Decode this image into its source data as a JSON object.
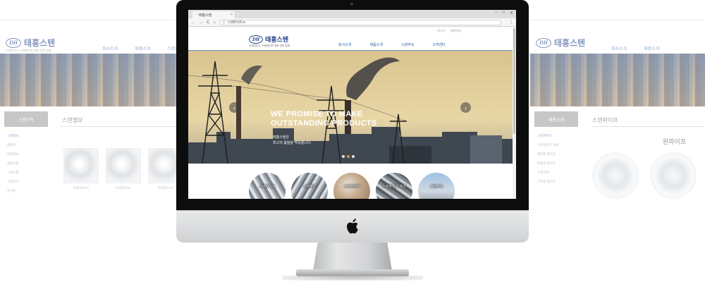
{
  "browser": {
    "tab_title": "태흥스텐",
    "url": "스텐파이프.kr",
    "tab_close": "×",
    "window_controls": [
      "–",
      "□",
      "✕"
    ],
    "nav_buttons": [
      "←",
      "→",
      "C",
      "⌂"
    ],
    "menu": "⋮"
  },
  "site": {
    "logo_badge": "DH",
    "logo_text": "태흥스텐",
    "tagline": "스테인리스, 스텐파이프 제작 전문 업체",
    "util_links": [
      "로그인",
      "회원가입"
    ],
    "nav": [
      "회사소개",
      "제품소개",
      "스텐부속",
      "고객센터"
    ]
  },
  "hero": {
    "headline_line1": "WE PROMISE TO MAKE",
    "headline_line2": "OUTSTANDING PRODUCTS",
    "sub_line1": "태흥스텐은",
    "sub_line2": "최고의 품질을 약속합니다.",
    "prev_arrow": "‹",
    "next_arrow": "›",
    "slide_count": 3,
    "active_slide": 1
  },
  "products": [
    {
      "label": "스텐파이프"
    },
    {
      "label": "스텐앵글"
    },
    {
      "label": "스텐플렌지"
    },
    {
      "label": "스텐파이프 제조"
    },
    {
      "label": "스텐부속"
    }
  ],
  "background_left": {
    "logo_text": "태흥스텐",
    "tagline": "스테인리스, 스텐파이프 제작 전문 업체",
    "nav": [
      "회사소개",
      "제품소개",
      "스텐부속"
    ],
    "side_head": "스텐부속",
    "section_title": "스텐엘보",
    "side_list": [
      "스텐엘보",
      "플렌지",
      "위생엘보",
      "클립니플",
      "스텐소켓",
      "스텐후크",
      "유니온"
    ],
    "thumbs": [
      "위생엘보90°",
      "위생엘보45°",
      "위생엘보45°"
    ]
  },
  "background_right": {
    "logo_text": "태흥스텐",
    "nav": [
      "회사소개",
      "제품소개"
    ],
    "side_head": "제품소개",
    "section_title": "스텐파이프",
    "side_list": [
      "스텐파이프",
      "스텐파이프 종류",
      "배관용 파이프",
      "위생용 파이프",
      "스텐각관",
      "구조용 파이프"
    ],
    "pipe_title": "원파이프"
  },
  "colors": {
    "brand_blue": "#1d3f8a",
    "nav_blue": "#2c5fa8",
    "accent_orange": "#f08a24"
  }
}
